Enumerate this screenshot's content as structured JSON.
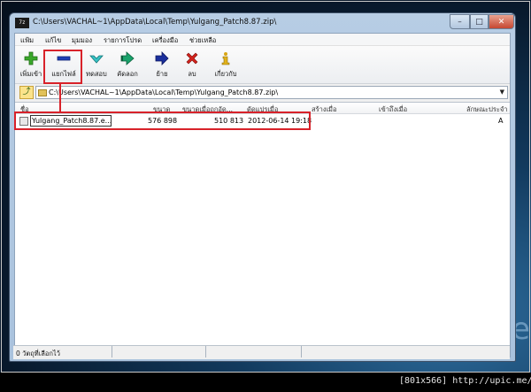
{
  "window": {
    "title": "C:\\Users\\VACHAL~1\\AppData\\Local\\Temp\\Yulgang_Patch8.87.zip\\",
    "app_icon": "7z"
  },
  "menubar": {
    "items": [
      {
        "label": "แฟ้ม"
      },
      {
        "label": "แก้ไข"
      },
      {
        "label": "มุมมอง"
      },
      {
        "label": "รายการโปรด"
      },
      {
        "label": "เครื่องมือ"
      },
      {
        "label": "ช่วยเหลือ"
      }
    ]
  },
  "toolbar": {
    "add_label": "เพิ่มเข้า",
    "extract_label": "แยกไฟล์",
    "test_label": "ทดสอบ",
    "copy_label": "คัดลอก",
    "move_label": "ย้าย",
    "delete_label": "ลบ",
    "info_label": "เกี่ยวกับ"
  },
  "address": {
    "path": "C:\\Users\\VACHAL~1\\AppData\\Local\\Temp\\Yulgang_Patch8.87.zip\\"
  },
  "columns": {
    "name": "ชื่อ",
    "size": "ขนาด",
    "packed": "ขนาดเมื่อถูกอัด...",
    "modified": "ดัดแปรเมื่อ",
    "created": "สร้างเมื่อ",
    "accessed": "เข้าถึงเมื่อ",
    "attributes": "ลักษณะประจำ"
  },
  "files": [
    {
      "name": "Yulgang_Patch8.87.e...",
      "size": "576 898",
      "packed": "510 813",
      "modified": "2012-06-14 19:18",
      "attributes": "A"
    }
  ],
  "status": {
    "text": "0 วัตถุที่เลือกไว้"
  },
  "watermark": "[801x566] http://upic.me/",
  "colors": {
    "highlight": "#d8222a",
    "window_frame": "#b7cde4"
  }
}
